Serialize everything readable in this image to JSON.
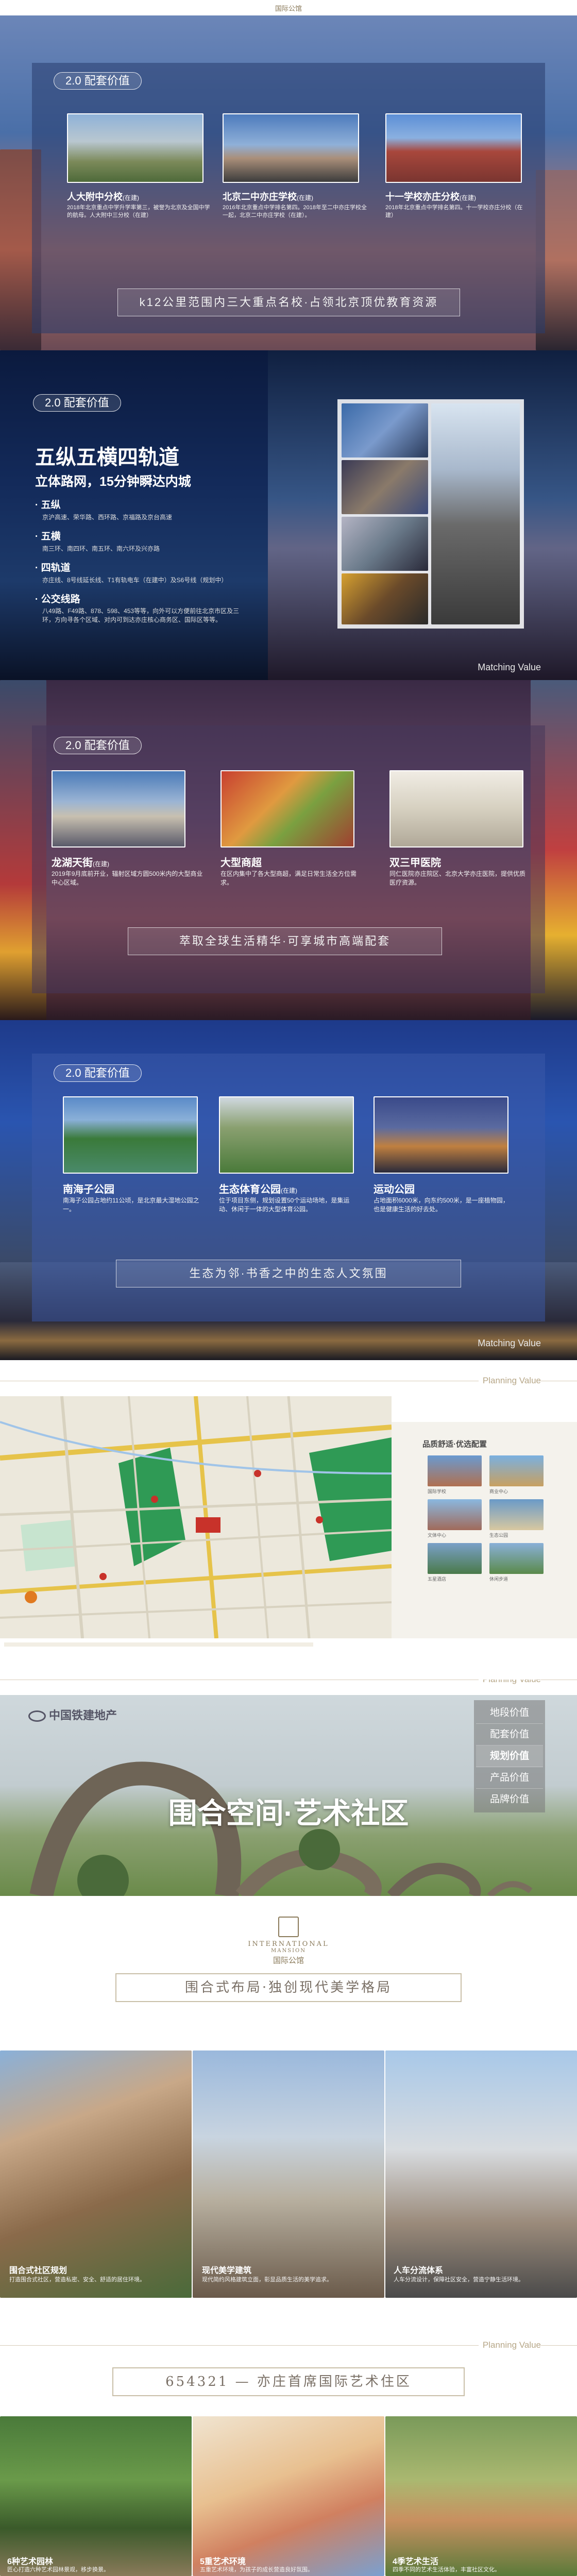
{
  "header": {
    "logo": "国际公馆"
  },
  "s1": {
    "tag": "2.0 配套价值",
    "cards": [
      {
        "caption": "人大附中分校",
        "sub": "(在建)",
        "text": "2018年北京重点中学升学率第三，被誉为北京及全国中学的航母。人大附中三分校（在建）"
      },
      {
        "caption": "北京二中亦庄学校",
        "sub": "(在建)",
        "text": "2016年北京重点中学排名第四。2018年至二中亦庄学校全一起，北京二中亦庄学校（在建）。"
      },
      {
        "caption": "十一学校亦庄分校",
        "sub": "(在建)",
        "text": "2018年北京重点中学排名第四。十一学校亦庄分校（在建）"
      }
    ],
    "slogan": "k12公里范围内三大重点名校·占领北京顶优教育资源"
  },
  "s2": {
    "tag": "2.0 配套价值",
    "title": "五纵五横四轨道",
    "subtitle": "立体路网，15分钟瞬达内城",
    "items": [
      {
        "h": "五纵",
        "t": "京沪高速、荣华路、西环路、京福路及京台高速"
      },
      {
        "h": "五横",
        "t": "南三环、南四环、南五环、南六环及兴亦路"
      },
      {
        "h": "四轨道",
        "t": "亦庄线、8号线延长线、T1有轨电车（在建中）及S6号线（规划中）"
      },
      {
        "h": "公交线路",
        "t": "八49路、F49路、878、598、453等等，向外可以方便前往北京市区及三环，方向寻各个区域、对内可到达亦庄核心商务区、国际区等等。"
      }
    ],
    "mark": "Matching Value"
  },
  "s3": {
    "tag": "2.0 配套价值",
    "cards": [
      {
        "caption": "龙湖天街",
        "sub": "(在建)",
        "text": "2019年9月底前开业，辐射区域方圆500米内的大型商业中心区域。"
      },
      {
        "caption": "大型商超",
        "sub": "",
        "text": "在区内集中了各大型商超，满足日常生活全方位需求。"
      },
      {
        "caption": "双三甲医院",
        "sub": "",
        "text": "同仁医院亦庄院区、北京大学亦庄医院，提供优质医疗资源。"
      }
    ],
    "slogan": "萃取全球生活精华·可享城市高端配套"
  },
  "s4": {
    "tag": "2.0 配套价值",
    "cards": [
      {
        "caption": "南海子公园",
        "sub": "",
        "text": "南海子公园占地约11公顷，是北京最大湿地公园之一。"
      },
      {
        "caption": "生态体育公园",
        "sub": "(在建)",
        "text": "位于项目东侧，规划设置50个运动场地，是集运动、休闲于一体的大型体育公园。"
      },
      {
        "caption": "运动公园",
        "sub": "",
        "text": "占地面积6000米，向东约500米，是一座植物园，也是健康生活的好去处。"
      }
    ],
    "slogan": "生态为邻·书香之中的生态人文氛围",
    "mark": "Matching Value"
  },
  "s5": {
    "mark": "Planning Value",
    "panel_title": "品质舒适·优选配置",
    "panel_items": [
      "国际学校",
      "商业中心",
      "文体中心",
      "生态公园",
      "五星酒店",
      "休闲步道"
    ]
  },
  "s6": {
    "mark": "Planning Value",
    "developer": "中国铁建地产",
    "title": "围合空间·艺术社区",
    "menu": [
      "地段价值",
      "配套价值",
      "规划价值",
      "产品价值",
      "品牌价值"
    ],
    "menu_active": 2
  },
  "s7": {
    "brand_en": "INTERNATIONAL",
    "brand_en2": "MANSION",
    "brand_cn": "国际公馆",
    "slogan": "围合式布局·独创现代美学格局",
    "cards": [
      {
        "caption": "围合式社区规划",
        "text": "打造围合式社区，营造私密、安全、舒适的居住环境。"
      },
      {
        "caption": "现代美学建筑",
        "text": "现代简约风格建筑立面，彰显品质生活的美学追求。"
      },
      {
        "caption": "人车分流体系",
        "text": "人车分流设计，保障社区安全，营造宁静生活环境。"
      }
    ]
  },
  "s8": {
    "mark": "Planning Value",
    "slogan": "654321 — 亦庄首席国际艺术住区",
    "cards": [
      {
        "caption": "6种艺术园林",
        "text": "匠心打造六种艺术园林景观，移步换景。"
      },
      {
        "caption": "5重艺术环境",
        "text": "五重艺术环境，为孩子的成长营造良好氛围。"
      },
      {
        "caption": "4季艺术生活",
        "text": "四季不同的艺术生活体验，丰富社区文化。"
      }
    ]
  },
  "colors": {
    "gold": "#b7a788",
    "navy": "#1e2b54",
    "blue": "#2a4aa8"
  }
}
